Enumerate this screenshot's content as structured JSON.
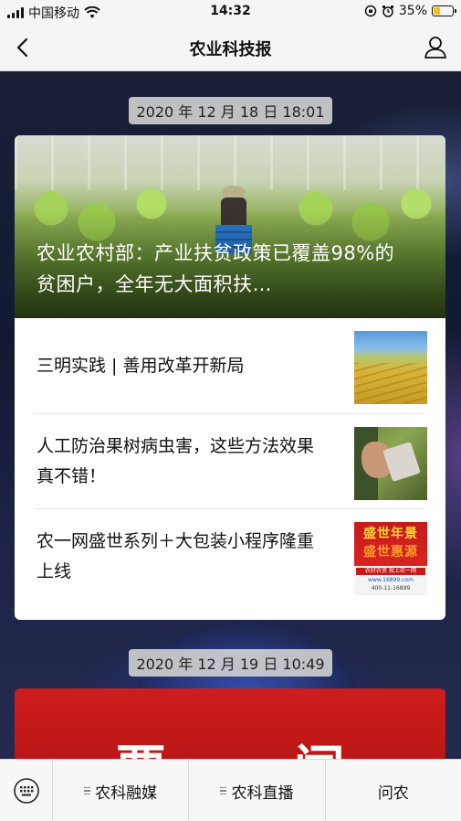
{
  "status_bar": {
    "carrier": "中国移动",
    "time": "14:32",
    "battery": "35%",
    "battery_level": 0.35
  },
  "nav": {
    "title": "农业科技报"
  },
  "feed": [
    {
      "timestamp": "2020 年 12 月 18 日  18:01",
      "headline": "农业农村部：产业扶贫政策已覆盖98%的贫困户，全年无大面积扶…",
      "items": [
        {
          "title": "三明实践 | 善用改革开新局",
          "thumb": "farm-field"
        },
        {
          "title": "人工防治果树病虫害，这些方法效果真不错！",
          "thumb": "hands-bagging-fruit"
        },
        {
          "title": "农一网盛世系列＋大包装小程序隆重上线",
          "thumb": "promo-poster",
          "thumb_text": [
            "盛世年景",
            "盛世惠源",
            "农好农资 就上农一网",
            "www.16899.com",
            "400-11-16899"
          ]
        }
      ]
    },
    {
      "timestamp": "2020 年 12 月 19 日  10:49",
      "headline_partial": "要 闻"
    }
  ],
  "tab_bar": {
    "tabs": [
      "农科融媒",
      "农科直播",
      "问农"
    ]
  },
  "colors": {
    "accent_red": "#cf1d1d",
    "battery_fill": "#f4c01b",
    "timestamp_bg": "#d2d2d2"
  }
}
